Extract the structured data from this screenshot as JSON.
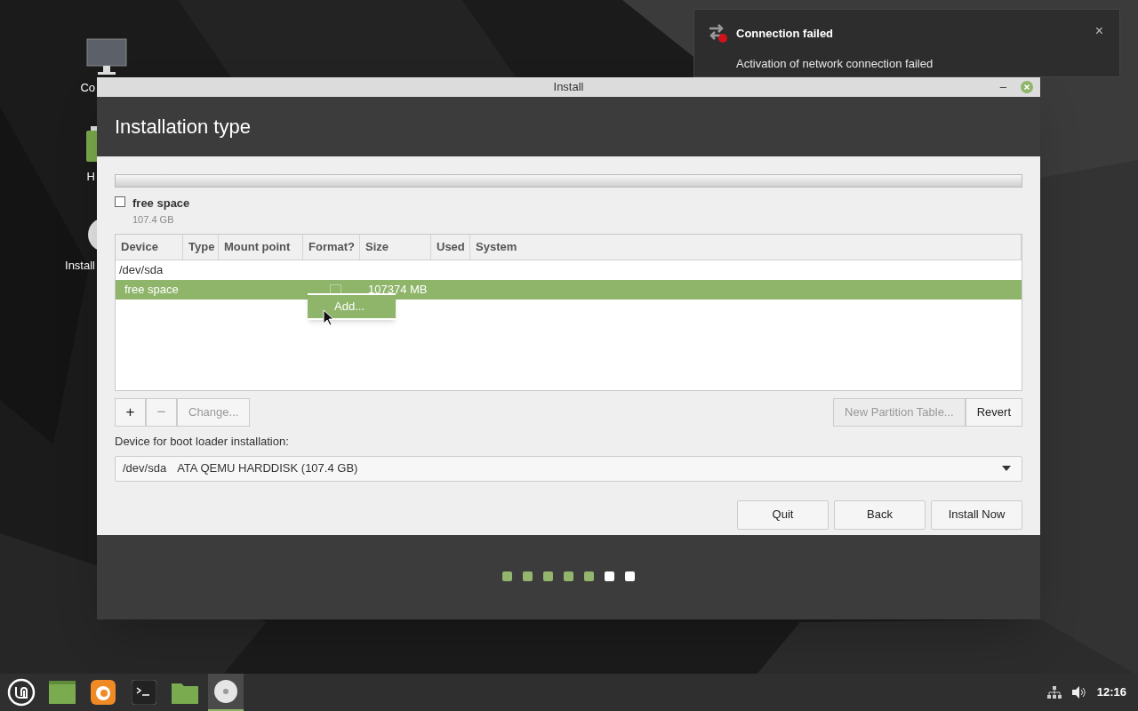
{
  "desktop_icons": [
    {
      "kind": "monitor",
      "label": "Co"
    },
    {
      "kind": "battery",
      "label": "H"
    },
    {
      "kind": "disc",
      "label": "Install"
    }
  ],
  "notification": {
    "title": "Connection failed",
    "message": "Activation of network connection failed",
    "close": "×"
  },
  "window": {
    "title": "Install",
    "minimize": "–",
    "header": "Installation type",
    "partition_legend": {
      "label": "free space",
      "size": "107.4 GB",
      "checked": false
    },
    "table": {
      "columns": [
        "Device",
        "Type",
        "Mount point",
        "Format?",
        "Size",
        "Used",
        "System"
      ],
      "rows": [
        {
          "kind": "disk",
          "device": "/dev/sda",
          "selected": false
        },
        {
          "kind": "partition",
          "device": "free space",
          "format": false,
          "size": "107374 MB",
          "selected": true
        }
      ]
    },
    "context_menu": [
      {
        "label": "Add...",
        "selected": true
      }
    ],
    "partition_buttons": [
      {
        "label": "+",
        "disabled": false
      },
      {
        "label": "−",
        "disabled": true
      },
      {
        "label": "Change...",
        "disabled": true
      }
    ],
    "table_buttons": [
      {
        "label": "New Partition Table...",
        "disabled": true
      },
      {
        "label": "Revert",
        "disabled": false
      }
    ],
    "boot_loader": {
      "label": "Device for boot loader installation:",
      "device": "/dev/sda",
      "description": "ATA QEMU HARDDISK (107.4 GB)"
    },
    "buttons": [
      "Quit",
      "Back",
      "Install Now"
    ],
    "steps": [
      {
        "done": true
      },
      {
        "done": true
      },
      {
        "done": true
      },
      {
        "done": true
      },
      {
        "done": true
      },
      {
        "done": false
      },
      {
        "done": false
      }
    ]
  },
  "taskbar": {
    "items": [
      {
        "kind": "menu",
        "selected": false
      },
      {
        "kind": "desktop",
        "selected": false
      },
      {
        "kind": "browser",
        "selected": false
      },
      {
        "kind": "terminal",
        "selected": false
      },
      {
        "kind": "folder",
        "selected": false
      },
      {
        "kind": "disc",
        "selected": true
      }
    ],
    "clock": "12:16"
  }
}
